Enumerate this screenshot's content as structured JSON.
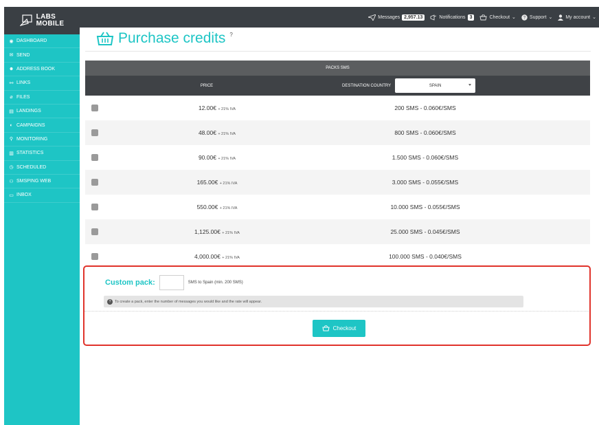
{
  "brand": {
    "logo_line1": "LABS",
    "logo_line2": "MOBILE",
    "accent": "#1ec5c5",
    "dark": "#3a3f44",
    "highlight": "#e0322a"
  },
  "sidebar": {
    "items": [
      {
        "label": "DASHBOARD",
        "icon": "dashboard-icon"
      },
      {
        "label": "SEND",
        "icon": "envelope-icon"
      },
      {
        "label": "ADDRESS BOOK",
        "icon": "users-icon"
      },
      {
        "label": "LINKS",
        "icon": "link-icon"
      },
      {
        "label": "FILES",
        "icon": "paperclip-icon"
      },
      {
        "label": "LANDINGS",
        "icon": "layout-icon"
      },
      {
        "label": "CAMPAIGNS",
        "icon": "megaphone-icon"
      },
      {
        "label": "MONITORING",
        "icon": "search-icon"
      },
      {
        "label": "STATISTICS",
        "icon": "bar-chart-icon"
      },
      {
        "label": "SCHEDULED",
        "icon": "clock-icon"
      },
      {
        "label": "SMSPING WEB",
        "icon": "ping-icon"
      },
      {
        "label": "INBOX",
        "icon": "inbox-icon"
      }
    ]
  },
  "topbar": {
    "messages_label": "Messages",
    "messages_count": "2,957.13",
    "notifications_label": "Notifications",
    "notifications_count": "3",
    "checkout_label": "Checkout",
    "support_label": "Support",
    "account_label": "My account"
  },
  "page": {
    "title": "Purchase credits",
    "help_mark": "?"
  },
  "table": {
    "group_header": "PACKS SMS",
    "price_header": "PRICE",
    "destination_header": "DESTINATION COUNTRY",
    "country": "SPAIN",
    "rows": [
      {
        "price": "12.00€",
        "tax": "+ 21% IVA",
        "sms": "200 SMS - 0.060€/SMS"
      },
      {
        "price": "48.00€",
        "tax": "+ 21% IVA",
        "sms": "800 SMS - 0.060€/SMS"
      },
      {
        "price": "90.00€",
        "tax": "+ 21% IVA",
        "sms": "1.500 SMS - 0.060€/SMS"
      },
      {
        "price": "165.00€",
        "tax": "+ 21% IVA",
        "sms": "3.000 SMS - 0.055€/SMS"
      },
      {
        "price": "550.00€",
        "tax": "+ 21% IVA",
        "sms": "10.000 SMS - 0.055€/SMS"
      },
      {
        "price": "1,125.00€",
        "tax": "+ 21% IVA",
        "sms": "25.000 SMS - 0.045€/SMS"
      },
      {
        "price": "4,000.00€",
        "tax": "+ 21% IVA",
        "sms": "100.000 SMS - 0.040€/SMS"
      }
    ]
  },
  "custom": {
    "label": "Custom pack:",
    "input_value": "",
    "suffix": "SMS to Spain (min. 200 SMS)",
    "hint": "To create a pack, enter the number of messages you would like and the rate will appear.",
    "checkout_label": "Checkout"
  }
}
